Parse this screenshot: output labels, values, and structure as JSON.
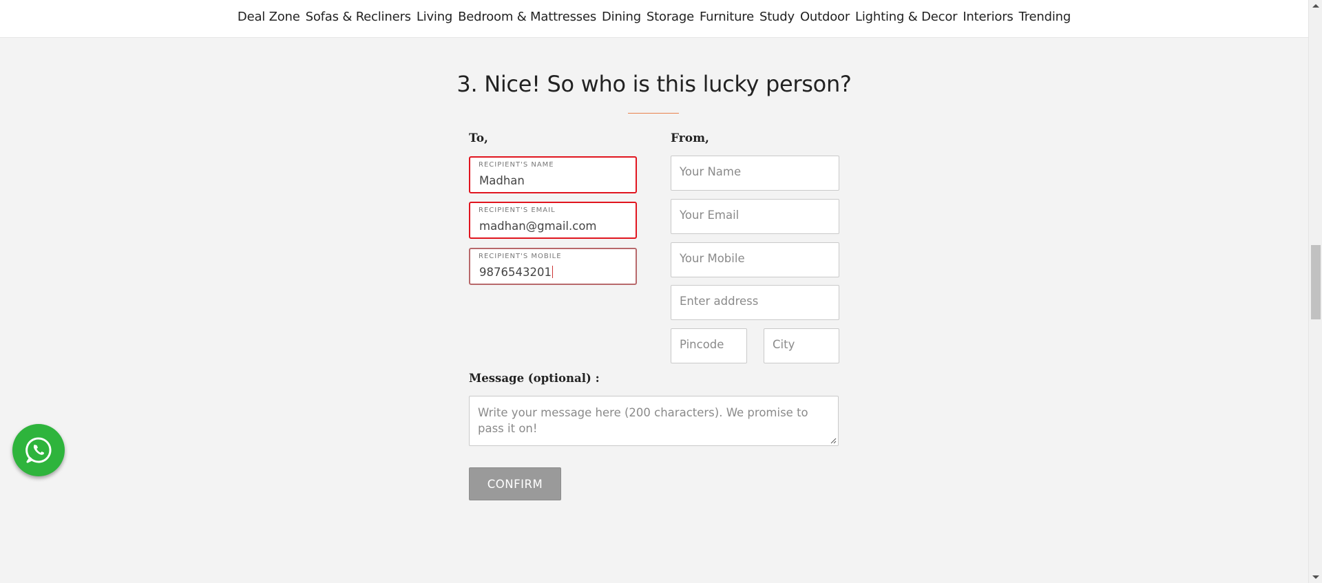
{
  "nav": {
    "items": [
      "Deal Zone",
      "Sofas & Recliners",
      "Living",
      "Bedroom & Mattresses",
      "Dining",
      "Storage",
      "Furniture",
      "Study",
      "Outdoor",
      "Lighting & Decor",
      "Interiors",
      "Trending"
    ]
  },
  "section": {
    "title": "3. Nice! So who is this lucky person?"
  },
  "to": {
    "label": "To,",
    "name_label": "RECIPIENT'S NAME",
    "name_value": "Madhan",
    "email_label": "RECIPIENT'S EMAIL",
    "email_value": "madhan@gmail.com",
    "mobile_label": "RECIPIENT'S MOBILE",
    "mobile_value": "9876543201"
  },
  "from": {
    "label": "From,",
    "name_placeholder": "Your Name",
    "email_placeholder": "Your Email",
    "mobile_placeholder": "Your Mobile",
    "address_placeholder": "Enter address",
    "pincode_placeholder": "Pincode",
    "city_placeholder": "City"
  },
  "message": {
    "label": "Message (optional) :",
    "placeholder": "Write your message here (200 characters). We promise to pass it on!"
  },
  "confirm_label": "CONFIRM",
  "floating": {
    "icon": "whatsapp-icon",
    "color": "#2eb43c"
  },
  "colors": {
    "error_border": "#e0141e",
    "accent_rule": "#e8804c",
    "button_bg": "#9a9a9a"
  }
}
